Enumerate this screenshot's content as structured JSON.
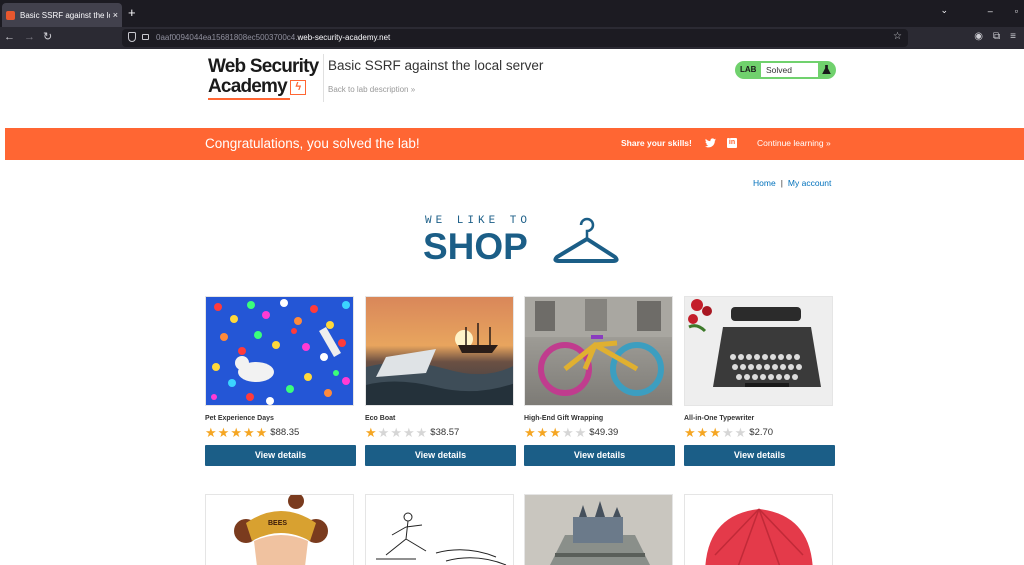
{
  "browser": {
    "tab_title": "Basic SSRF against the lo",
    "tab_close": "×",
    "new_tab": "+",
    "url_prefix": "0aaf0094044ea15681808ec5003700c4.",
    "url_domain": "web-security-academy.net",
    "icons": [
      "back-icon",
      "forward-icon",
      "reload-icon",
      "shield-icon",
      "lock-icon",
      "star-icon",
      "account-icon",
      "extensions-icon",
      "menu-icon"
    ]
  },
  "header": {
    "logo_line1": "Web Security",
    "logo_line2": "Academy",
    "lab_title": "Basic SSRF against the local server",
    "back_link": "Back to lab description »",
    "lab_badge": "LAB",
    "lab_status": "Solved"
  },
  "banner": {
    "message": "Congratulations, you solved the lab!",
    "share_label": "Share your skills!",
    "continue_label": "Continue learning »",
    "color": "#ff6633"
  },
  "nav": {
    "home": "Home",
    "separator": "|",
    "account": "My account"
  },
  "hero": {
    "tagline": "WE LIKE TO",
    "title": "SHOP"
  },
  "products": [
    {
      "name": "Pet Experience Days",
      "rating": 5,
      "price": "$88.35",
      "button": "View details"
    },
    {
      "name": "Eco Boat",
      "rating": 1,
      "price": "$38.57",
      "button": "View details"
    },
    {
      "name": "High-End Gift Wrapping",
      "rating": 3,
      "price": "$49.39",
      "button": "View details"
    },
    {
      "name": "All-in-One Typewriter",
      "rating": 3,
      "price": "$2.70",
      "button": "View details"
    }
  ],
  "colors": {
    "accent": "#1b5e87",
    "lab_solved": "#70d16d",
    "star": "#f5a623"
  }
}
